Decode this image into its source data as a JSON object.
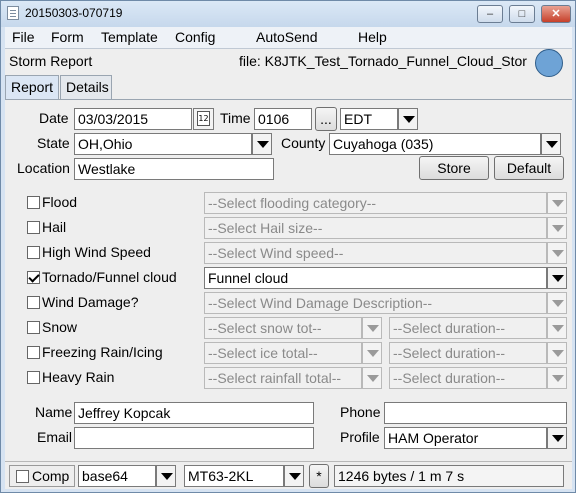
{
  "window": {
    "title": "20150303-070719"
  },
  "menu": [
    "File",
    "Form",
    "Template",
    "Config",
    "AutoSend",
    "Help"
  ],
  "header": {
    "report_title": "Storm Report",
    "file_label": "file: K8JTK_Test_Tornado_Funnel_Cloud_Stor"
  },
  "tabs": [
    "Report",
    "Details"
  ],
  "form": {
    "date_label": "Date",
    "date_value": "03/03/2015",
    "time_label": "Time",
    "time_value": "0106",
    "time_more": "...",
    "timezone": "EDT",
    "state_label": "State",
    "state_value": "OH,Ohio",
    "county_label": "County",
    "county_value": "Cuyahoga  (035)",
    "location_label": "Location",
    "location_value": "Westlake",
    "store_label": "Store",
    "default_label": "Default"
  },
  "hazards": [
    {
      "label": "Flood",
      "checked": false,
      "select1": "--Select flooding category--"
    },
    {
      "label": "Hail",
      "checked": false,
      "select1": "--Select Hail size--"
    },
    {
      "label": "High Wind Speed",
      "checked": false,
      "select1": "--Select Wind speed--"
    },
    {
      "label": "Tornado/Funnel cloud",
      "checked": true,
      "select1": "Funnel cloud"
    },
    {
      "label": "Wind Damage?",
      "checked": false,
      "select1": "--Select Wind Damage Description--"
    },
    {
      "label": "Snow",
      "checked": false,
      "select1": "--Select snow tot--",
      "select2": "--Select duration--"
    },
    {
      "label": "Freezing Rain/Icing",
      "checked": false,
      "select1": "--Select ice total--",
      "select2": "--Select duration--"
    },
    {
      "label": "Heavy Rain",
      "checked": false,
      "select1": "--Select rainfall total--",
      "select2": "--Select duration--"
    }
  ],
  "contact": {
    "name_label": "Name",
    "name_value": "Jeffrey Kopcak",
    "phone_label": "Phone",
    "phone_value": "",
    "email_label": "Email",
    "email_value": "",
    "profile_label": "Profile",
    "profile_value": "HAM Operator"
  },
  "status": {
    "comp_label": "Comp",
    "encoding": "base64",
    "mode": "MT63-2KL",
    "star": "*",
    "size_info": "1246 bytes / 1 m 7 s"
  }
}
